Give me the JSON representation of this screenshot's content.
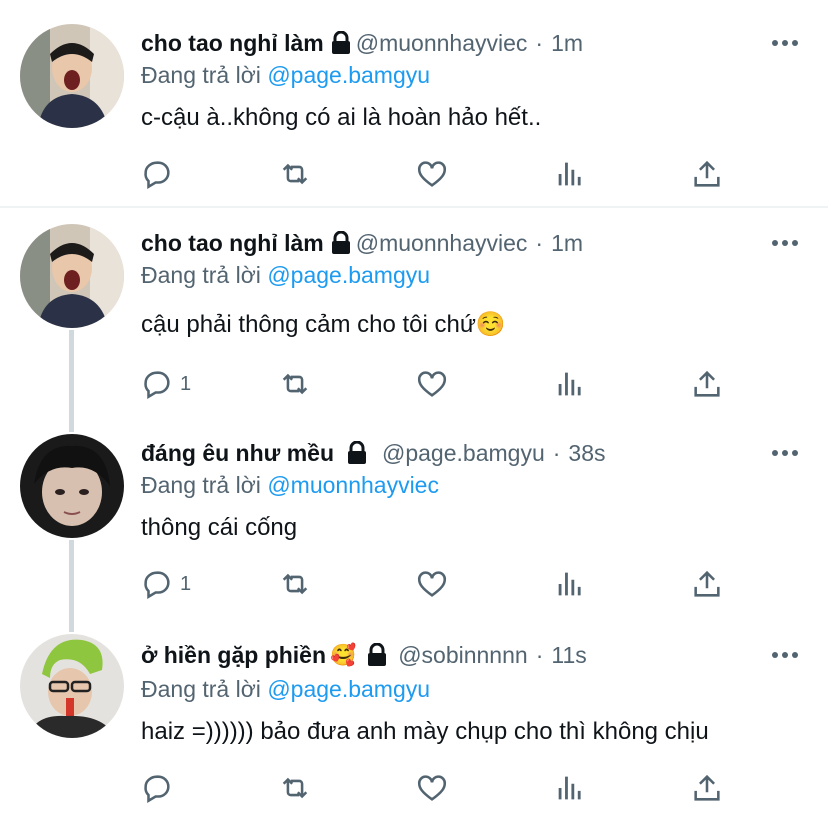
{
  "tweets": [
    {
      "name": "cho tao nghỉ làm",
      "name_emoji": "",
      "handle": "@muonnhayviec",
      "time": "1m",
      "reply_prefix": "Đang trả lời",
      "reply_to": "@page.bamgyu",
      "text": "c-cậu à..không có ai là hoàn hảo hết..",
      "reply_count": ""
    },
    {
      "name": "cho tao nghỉ làm",
      "name_emoji": "",
      "handle": "@muonnhayviec",
      "time": "1m",
      "reply_prefix": "Đang trả lời",
      "reply_to": "@page.bamgyu",
      "text": "cậu phải thông cảm cho tôi chứ☺️",
      "reply_count": "1"
    },
    {
      "name": "đáng êu như mều",
      "name_emoji": "",
      "handle": "@page.bamgyu",
      "time": "38s",
      "reply_prefix": "Đang trả lời",
      "reply_to": "@muonnhayviec",
      "text": "thông cái cống",
      "reply_count": "1"
    },
    {
      "name": "ở hiền gặp phiền",
      "name_emoji": "🥰",
      "handle": "@sobinnnnn",
      "time": "11s",
      "reply_prefix": "Đang trả lời",
      "reply_to": "@page.bamgyu",
      "text": "haiz =)))))) bảo đưa anh mày chụp cho thì không chịu",
      "reply_count": ""
    }
  ],
  "separator": "·",
  "icons": [
    "reply-icon",
    "retweet-icon",
    "like-icon",
    "analytics-icon",
    "share-icon",
    "lock-icon",
    "more-icon"
  ],
  "colors": {
    "mention": "#1d9bf0",
    "secondary": "#536471",
    "primary": "#0f1419",
    "thread_line": "#cfd9de"
  }
}
